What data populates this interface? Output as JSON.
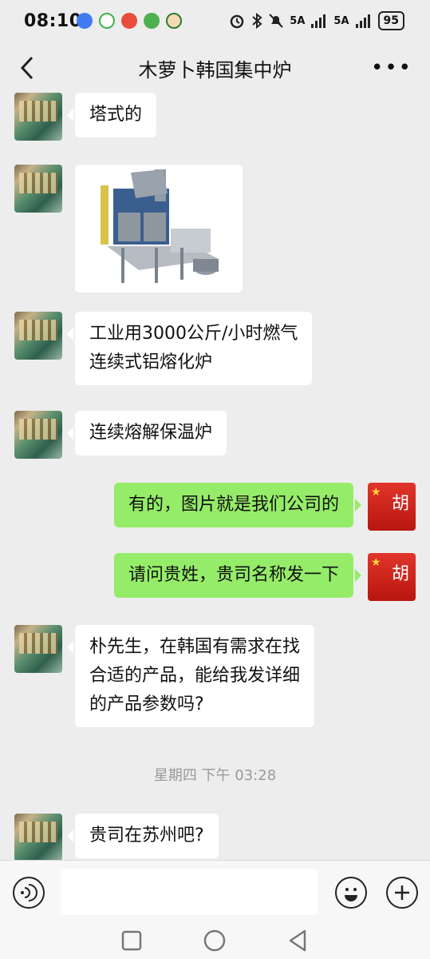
{
  "status_bar": {
    "time": "08:10",
    "signal1": "5A",
    "signal2": "5A",
    "battery": "95"
  },
  "header": {
    "title": "木萝卜韩国集中炉",
    "back_icon": "chevron-left-icon",
    "more_label": "•••"
  },
  "messages": [
    {
      "side": "in",
      "text": "塔式的"
    },
    {
      "side": "in",
      "type": "image",
      "icon": "furnace-image"
    },
    {
      "side": "in",
      "line1": "工业用3000公斤/小时燃气",
      "line2": "连续式铝熔化炉"
    },
    {
      "side": "in",
      "text": "连续熔解保温炉"
    },
    {
      "side": "out",
      "text": "有的，图片就是我们公司的"
    },
    {
      "side": "out",
      "text": "请问贵姓，贵司名称发一下"
    },
    {
      "side": "in",
      "line1": "朴先生，在韩国有需求在找",
      "line2": "合适的产品，能给我发详细",
      "line3": "的产品参数吗?"
    },
    {
      "side": "in",
      "text": "贵司在苏州吧?"
    }
  ],
  "timestamp": "星期四 下午 03:28",
  "avatar_out_char": "胡",
  "avatar_out_star": "★",
  "colors": {
    "background": "#ededed",
    "bubble_in": "#ffffff",
    "bubble_out": "#95ec69",
    "avatar_out": "#d42a1e"
  }
}
